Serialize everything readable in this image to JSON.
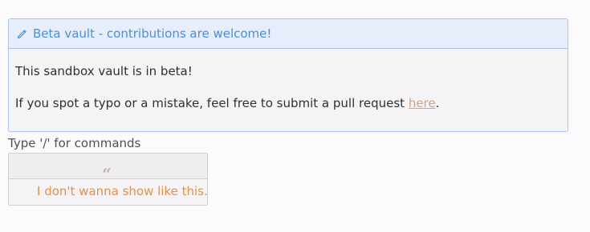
{
  "callout": {
    "title": "Beta vault - contributions are welcome!",
    "line1": "This sandbox vault is in beta!",
    "line2_prefix": "If you spot a typo or a mistake, feel free to submit a pull request ",
    "link_text": "here",
    "line2_suffix": ".",
    "icon": "pencil-icon"
  },
  "hint": {
    "text": "Type '/' for commands"
  },
  "quote": {
    "icon": "quote-icon",
    "text": "I don't wanna show like this..."
  },
  "colors": {
    "callout_border": "#a9c4ea",
    "callout_title": "#4a90d6",
    "link": "#d4a37e",
    "quote_text": "#e0914a"
  }
}
